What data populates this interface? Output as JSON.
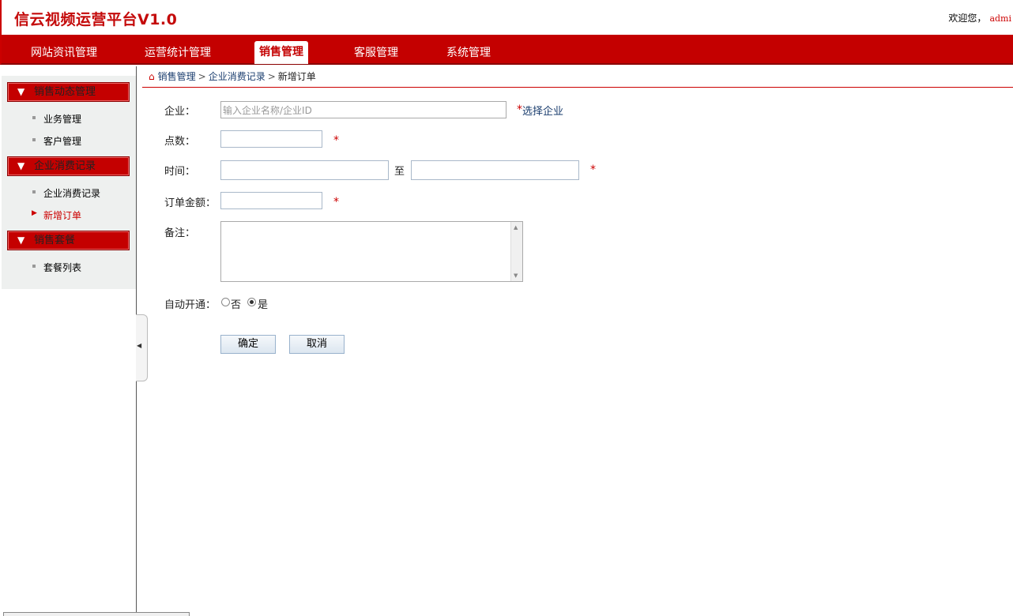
{
  "header": {
    "title": "信云视频运营平台V1.0",
    "welcome": "欢迎您，",
    "user": "admi"
  },
  "nav": {
    "tabs": [
      "网站资讯管理",
      "运营统计管理",
      "销售管理",
      "客服管理",
      "系统管理"
    ],
    "active": "销售管理"
  },
  "sidebar": {
    "groups": [
      {
        "title": "销售动态管理",
        "items": [
          "业务管理",
          "客户管理"
        ]
      },
      {
        "title": "企业消费记录",
        "items": [
          "企业消费记录",
          "新增订单"
        ]
      },
      {
        "title": "销售套餐",
        "items": [
          "套餐列表"
        ]
      }
    ],
    "current_item": "新增订单"
  },
  "breadcrumb": {
    "items": [
      "销售管理",
      "企业消费记录",
      "新增订单"
    ]
  },
  "form": {
    "company_label": "企业：",
    "company_placeholder": "输入企业名称/企业ID",
    "choose_company_req": "*",
    "choose_company": "选择企业",
    "points_label": "点数：",
    "time_label": "时间：",
    "time_to": "至",
    "amount_label": "订单金额：",
    "remark_label": "备注：",
    "auto_open_label": "自动开通：",
    "radio_no": "否",
    "radio_yes": "是",
    "radio_selected": "是",
    "required_mark": "*"
  },
  "buttons": {
    "confirm": "确定",
    "cancel": "取消"
  }
}
